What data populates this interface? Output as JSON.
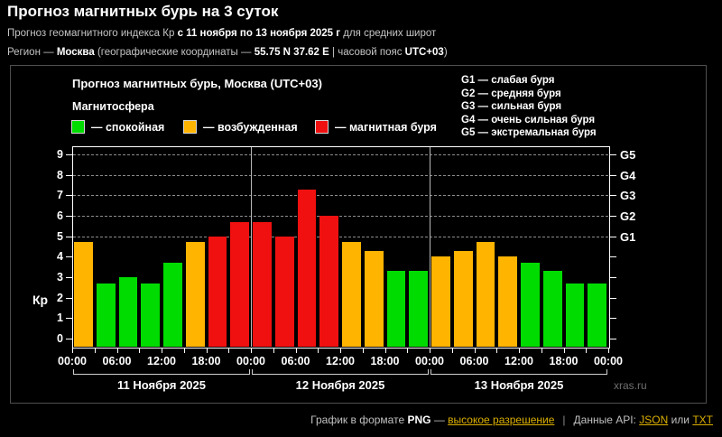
{
  "page": {
    "title": "Прогноз магнитных бурь на 3 суток",
    "subtitle_index": {
      "pre": "Прогноз геомагнитного индекса Кр ",
      "range": "с 11 ноября по 13 ноября 2025 г",
      "post": " для средних широт"
    },
    "subtitle_region": {
      "pre": "Регион — ",
      "region": "Москва",
      "mid": " (географические координаты — ",
      "coords": "55.75 N 37.62 E",
      "mid2": " | часовой пояс ",
      "tz": "UTC+03",
      "post": ")"
    }
  },
  "panel": {
    "chart_title": "Прогноз магнитных бурь, Москва (UTC+03)",
    "legend_title": "Магнитосфера",
    "legend": [
      {
        "state": "quiet",
        "label": "— спокойная"
      },
      {
        "state": "excited",
        "label": "— возбужденная"
      },
      {
        "state": "storm",
        "label": "— магнитная буря"
      }
    ],
    "g_scale": [
      "G1 — слабая буря",
      "G2 — средняя буря",
      "G3 — сильная буря",
      "G4 — очень сильная буря",
      "G5 — экстремальная буря"
    ],
    "watermark": "xras.ru"
  },
  "chart_data": {
    "type": "bar",
    "title": "Прогноз магнитных бурь, Москва (UTC+03)",
    "ylabel": "Кр",
    "ylim": [
      0,
      9
    ],
    "y_ticks": [
      0,
      1,
      2,
      3,
      4,
      5,
      6,
      7,
      8,
      9
    ],
    "x_tick_labels": [
      "00:00",
      "06:00",
      "12:00",
      "18:00",
      "00:00",
      "06:00",
      "12:00",
      "18:00",
      "00:00",
      "06:00",
      "12:00",
      "18:00",
      "00:00"
    ],
    "interval_hours": 3,
    "grid": "dashed lines at G storm levels only",
    "legend_position": "top-left",
    "g_ticks": {
      "labels": [
        "G1",
        "G2",
        "G3",
        "G4",
        "G5"
      ],
      "kp": [
        5,
        6,
        7,
        8,
        9
      ]
    },
    "state_colors": {
      "quiet": "#00dc00",
      "excited": "#ffb400",
      "storm": "#f01010"
    },
    "days": [
      {
        "date": "11 Ноября 2025",
        "values": [
          4.7,
          2.7,
          3.0,
          2.7,
          3.7,
          4.7,
          5.0,
          5.7
        ],
        "states": [
          "excited",
          "quiet",
          "quiet",
          "quiet",
          "quiet",
          "excited",
          "storm",
          "storm"
        ]
      },
      {
        "date": "12 Ноября 2025",
        "values": [
          5.7,
          5.0,
          7.3,
          6.0,
          4.7,
          4.3,
          3.3,
          3.3
        ],
        "states": [
          "storm",
          "storm",
          "storm",
          "storm",
          "excited",
          "excited",
          "quiet",
          "quiet"
        ]
      },
      {
        "date": "13 Ноября 2025",
        "values": [
          4.0,
          4.3,
          4.7,
          4.0,
          3.7,
          3.3,
          2.7,
          2.7
        ],
        "states": [
          "excited",
          "excited",
          "excited",
          "excited",
          "quiet",
          "quiet",
          "quiet",
          "quiet"
        ]
      }
    ]
  },
  "footer": {
    "png_pre": "График в формате ",
    "png_word": "PNG",
    "dash": " — ",
    "png_link": "высокое разрешение",
    "separator": "|",
    "api_label": "Данные API: ",
    "json_link": "JSON",
    "or_word": " или ",
    "txt_link": "TXT",
    "link_color": "#dcb000"
  }
}
